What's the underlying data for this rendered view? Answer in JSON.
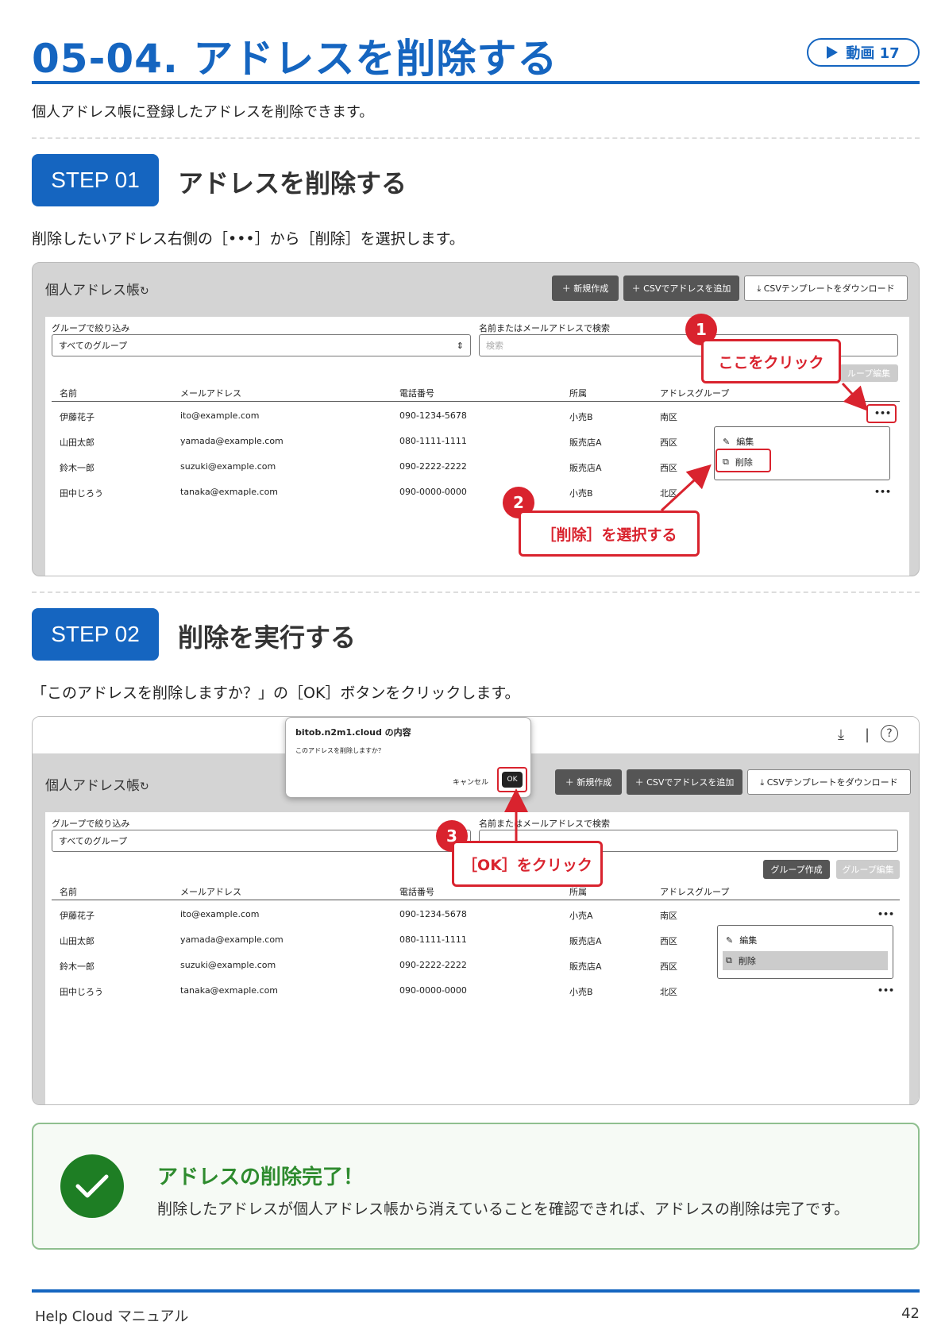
{
  "header": {
    "title": "05-04. アドレスを削除する",
    "video_label": "動画 17",
    "intro": "個人アドレス帳に登録したアドレスを削除できます。"
  },
  "step1": {
    "badge": "STEP 01",
    "heading": "アドレスを削除する",
    "description": "削除したいアドレス右側の［•••］から［削除］を選択します。",
    "callout1_num": "1",
    "callout1_text": "ここをクリック",
    "callout2_num": "2",
    "callout2_text": "［削除］を選択する"
  },
  "step2": {
    "badge": "STEP 02",
    "heading": "削除を実行する",
    "description": "「このアドレスを削除しますか？」の［OK］ボタンをクリックします。",
    "callout3_num": "3",
    "callout3_text": "［OK］をクリック"
  },
  "app": {
    "title": "個人アドレス帳",
    "refresh_icon": "↻",
    "new_button": "＋ 新規作成",
    "csv_add_button": "＋ CSVでアドレスを追加",
    "csv_template_button": "⤓ CSVテンプレートをダウンロード",
    "group_filter_label": "グループで絞り込み",
    "group_filter_value": "すべてのグループ",
    "search_label": "名前またはメールアドレスで検索",
    "search_placeholder": "検索",
    "group_create_button": "グループ作成",
    "group_edit_button": "グループ編集",
    "group_edit_partial": "ループ編集",
    "columns": [
      "名前",
      "メールアドレス",
      "電話番号",
      "所属",
      "アドレスグループ"
    ],
    "more_icon": "•••",
    "menu_edit": "編集",
    "menu_delete": "削除"
  },
  "rows1": [
    {
      "name": "伊藤花子",
      "email": "ito@example.com",
      "phone": "090-1234-5678",
      "org": "小売B",
      "group": "南区"
    },
    {
      "name": "山田太郎",
      "email": "yamada@example.com",
      "phone": "080-1111-1111",
      "org": "販売店A",
      "group": "西区"
    },
    {
      "name": "鈴木一郎",
      "email": "suzuki@example.com",
      "phone": "090-2222-2222",
      "org": "販売店A",
      "group": "西区"
    },
    {
      "name": "田中じろう",
      "email": "tanaka@exmaple.com",
      "phone": "090-0000-0000",
      "org": "小売B",
      "group": "北区"
    }
  ],
  "rows2": [
    {
      "name": "伊藤花子",
      "email": "ito@example.com",
      "phone": "090-1234-5678",
      "org": "小売A",
      "group": "南区"
    },
    {
      "name": "山田太郎",
      "email": "yamada@example.com",
      "phone": "080-1111-1111",
      "org": "販売店A",
      "group": "西区"
    },
    {
      "name": "鈴木一郎",
      "email": "suzuki@example.com",
      "phone": "090-2222-2222",
      "org": "販売店A",
      "group": "西区"
    },
    {
      "name": "田中じろう",
      "email": "tanaka@exmaple.com",
      "phone": "090-0000-0000",
      "org": "小売B",
      "group": "北区"
    }
  ],
  "dialog": {
    "title": "bitob.n2m1.cloud の内容",
    "message": "このアドレスを削除しますか？",
    "cancel": "キャンセル",
    "ok": "OK"
  },
  "browser_icons": {
    "download": "⤓",
    "separator": "|",
    "help": "?"
  },
  "done": {
    "title": "アドレスの削除完了！",
    "text": "削除したアドレスが個人アドレス帳から消えていることを確認できれば、アドレスの削除は完了です。"
  },
  "footer": {
    "left": "Help Cloud マニュアル",
    "page": "42"
  }
}
